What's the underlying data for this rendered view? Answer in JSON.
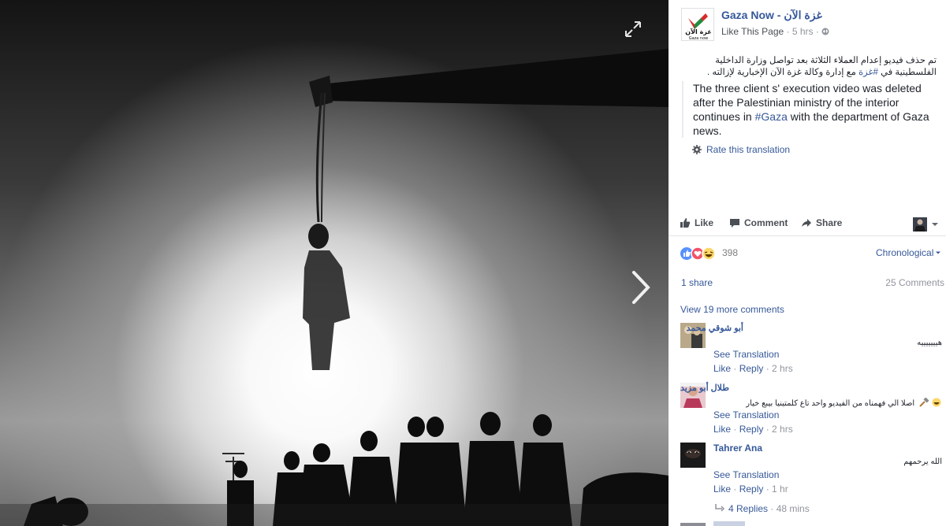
{
  "page": {
    "name": "Gaza Now - غزة الآن",
    "logo_text": "غزة الآن",
    "logo_sub": "Gaza now",
    "like_page": "Like This Page",
    "time": "5 hrs"
  },
  "post": {
    "arabic_line1": "تم حذف فيديو إعدام العملاء الثلاثة بعد تواصل وزارة الداخلية الفلسطينية في",
    "arabic_hashtag": "#غزة",
    "arabic_line2_rest": "مع إدارة وكالة غزة الآن الإخبارية لإزالته .",
    "translation_before": "The three client s' execution video was deleted after the Palestinian ministry of the interior continues in ",
    "translation_hashtag": "#Gaza",
    "translation_after": " with the department of Gaza news.",
    "rate_translation": "Rate this translation"
  },
  "actions": {
    "like": "Like",
    "comment": "Comment",
    "share": "Share"
  },
  "stats": {
    "reactions_count": "398",
    "sort": "Chronological",
    "shares": "1 share",
    "comments": "25 Comments",
    "view_more": "View 19 more comments"
  },
  "comments": [
    {
      "name": "أبو شوقي محمد",
      "text": "هيييييييه",
      "see_translation": "See Translation",
      "like": "Like",
      "reply": "Reply",
      "time": "2 hrs"
    },
    {
      "name": "طلال أبو مزيد",
      "text": "اصلا الي فهمناه من الفيديو واحد تاع كلمتينيا بيبع خيار",
      "see_translation": "See Translation",
      "like": "Like",
      "reply": "Reply",
      "time": "2 hrs"
    },
    {
      "name": "Tahrer Ana",
      "text": "الله يرحمهم",
      "see_translation": "See Translation",
      "like": "Like",
      "reply": "Reply",
      "time": "1 hr"
    }
  ],
  "replies": {
    "label": "4 Replies",
    "time": "48 mins"
  },
  "colors": {
    "link": "#365899",
    "meta": "#90949c",
    "text": "#1d2129",
    "like_blue": "#5890ff",
    "love_red": "#f25268",
    "haha_yellow": "#fcd669"
  },
  "icons": [
    "expand-icon",
    "next-arrow-icon",
    "globe-icon",
    "gear-icon",
    "like-thumb-icon",
    "comment-bubble-icon",
    "share-arrow-icon",
    "like-reaction-icon",
    "love-reaction-icon",
    "haha-reaction-icon",
    "reply-arrow-icon",
    "caret-down-icon"
  ]
}
